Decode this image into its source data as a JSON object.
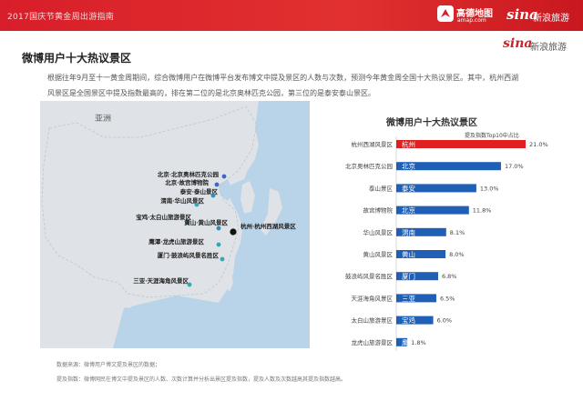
{
  "header": {
    "title": "2017国庆节黄金周出游指南",
    "gaode_name": "高德地图",
    "gaode_url": "amap.com",
    "sina_logo": "sina",
    "sina_name": "新浪旅游",
    "bar_color": "#d81e2a"
  },
  "page": {
    "title": "微博用户十大热议景区",
    "paragraph_line1": "根据往年9月至十一黄金周期间，综合微博用户在微博平台发布博文中提及景区的人数与次数，预测今年黄金周全国十大热议景区。其中，杭州西湖",
    "paragraph_line2": "风景区是全国景区中提及指数最高的，排在第二位的是北京奥林匹克公园，第三位的是泰安泰山景区。"
  },
  "map": {
    "region_label": "亚洲",
    "markers": [
      {
        "label": "北京·北京奥林匹克公园",
        "color": "#3d67c9"
      },
      {
        "label": "北京·故宫博物院",
        "color": "#3d67c9"
      },
      {
        "label": "泰安·泰山景区",
        "color": "#2e8fbf"
      },
      {
        "label": "渭南·华山风景区",
        "color": "#34a9b0"
      },
      {
        "label": "宝鸡·太白山旅游景区",
        "color": "#34a9b0"
      },
      {
        "label": "黄山·黄山风景区",
        "color": "#2e8fbf"
      },
      {
        "label": "杭州·杭州西湖风景区",
        "color": "#111111"
      },
      {
        "label": "鹰潭·龙虎山旅游景区",
        "color": "#34a9b0"
      },
      {
        "label": "厦门·鼓浪屿风景名胜区",
        "color": "#34a9b0"
      },
      {
        "label": "三亚·天涯海角风景区",
        "color": "#34a9b0"
      }
    ]
  },
  "chart_data": {
    "type": "bar",
    "orientation": "horizontal",
    "title": "微博用户十大热议景区",
    "series_label": "提及指数Top10中占比",
    "categories": [
      "杭州西湖风景区",
      "北京奥林匹克公园",
      "泰山景区",
      "故宫博物院",
      "华山风景区",
      "黄山风景区",
      "鼓浪屿风景名胜区",
      "天涯海角风景区",
      "太白山旅游景区",
      "龙虎山旅游景区"
    ],
    "cities": [
      "杭州",
      "北京",
      "泰安",
      "北京",
      "渭南",
      "黄山",
      "厦门",
      "三亚",
      "宝鸡",
      "鹰潭"
    ],
    "values": [
      21.0,
      17.0,
      13.0,
      11.8,
      8.1,
      8.0,
      6.8,
      6.5,
      6.0,
      1.8
    ],
    "value_labels": [
      "21.0%",
      "17.0%",
      "13.0%",
      "11.8%",
      "8.1%",
      "8.0%",
      "6.8%",
      "6.5%",
      "6.0%",
      "1.8%"
    ],
    "highlight_color": "#e02020",
    "bar_color": "#1f5fb6",
    "xlim": [
      0,
      21.0
    ]
  },
  "footer": {
    "source": "数据来源：微博用户博文提及景区的数据；",
    "definition": "提及指数：微博网民在博文中提及景区的人数、次数计算并分析出景区提及指数，提及人数及次数越高其提及指数越高。"
  }
}
